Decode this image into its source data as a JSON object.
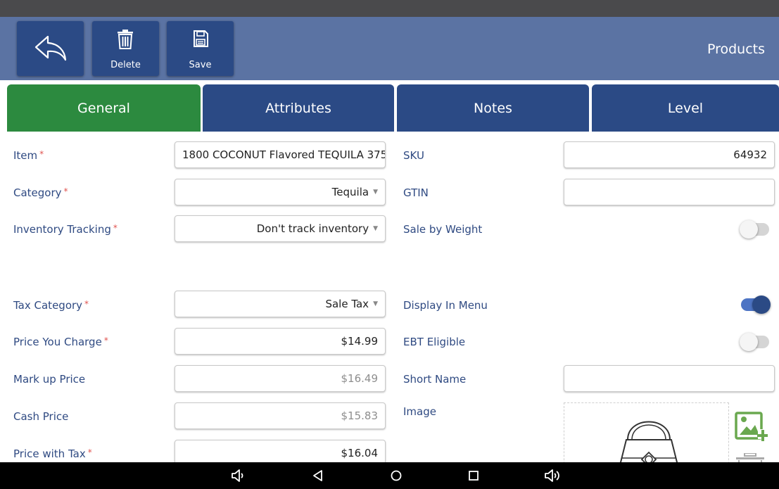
{
  "header": {
    "title": "Products",
    "delete_label": "Delete",
    "save_label": "Save"
  },
  "tabs": [
    {
      "label": "General",
      "active": true
    },
    {
      "label": "Attributes",
      "active": false
    },
    {
      "label": "Notes",
      "active": false
    },
    {
      "label": "Level",
      "active": false
    }
  ],
  "form": {
    "item": {
      "label": "Item",
      "required": true,
      "value": "1800 COCONUT Flavored TEQUILA 375"
    },
    "category": {
      "label": "Category",
      "required": true,
      "value": "Tequila"
    },
    "inventory_tracking": {
      "label": "Inventory Tracking",
      "required": true,
      "value": "Don't track inventory"
    },
    "tax_category": {
      "label": "Tax Category",
      "required": true,
      "value": "Sale Tax"
    },
    "price_you_charge": {
      "label": "Price You Charge",
      "required": true,
      "value": "$14.99"
    },
    "mark_up_price": {
      "label": "Mark up Price",
      "required": false,
      "value": "$16.49"
    },
    "cash_price": {
      "label": "Cash Price",
      "required": false,
      "value": "$15.83"
    },
    "price_with_tax": {
      "label": "Price with Tax",
      "required": true,
      "value": "$16.04"
    },
    "sku": {
      "label": "SKU",
      "value": "64932"
    },
    "gtin": {
      "label": "GTIN",
      "value": ""
    },
    "sale_by_weight": {
      "label": "Sale by Weight",
      "on": false
    },
    "display_in_menu": {
      "label": "Display In Menu",
      "on": true
    },
    "ebt_eligible": {
      "label": "EBT Eligible",
      "on": false
    },
    "short_name": {
      "label": "Short Name",
      "value": ""
    },
    "image": {
      "label": "Image"
    }
  },
  "required_mark": "*",
  "colors": {
    "toolbar": "#5b73a3",
    "button": "#2b4a85",
    "tab_active": "#2c8a3f",
    "label": "#2f4a82",
    "required": "#e0534f"
  },
  "icons": {
    "back": "back-arrow-icon",
    "delete": "trash-icon",
    "save": "floppy-disk-icon",
    "add_image": "add-image-icon",
    "remove_image": "delete-image-icon",
    "nav": [
      "volume-down-icon",
      "back-triangle-icon",
      "home-circle-icon",
      "recents-square-icon",
      "volume-up-icon"
    ]
  }
}
